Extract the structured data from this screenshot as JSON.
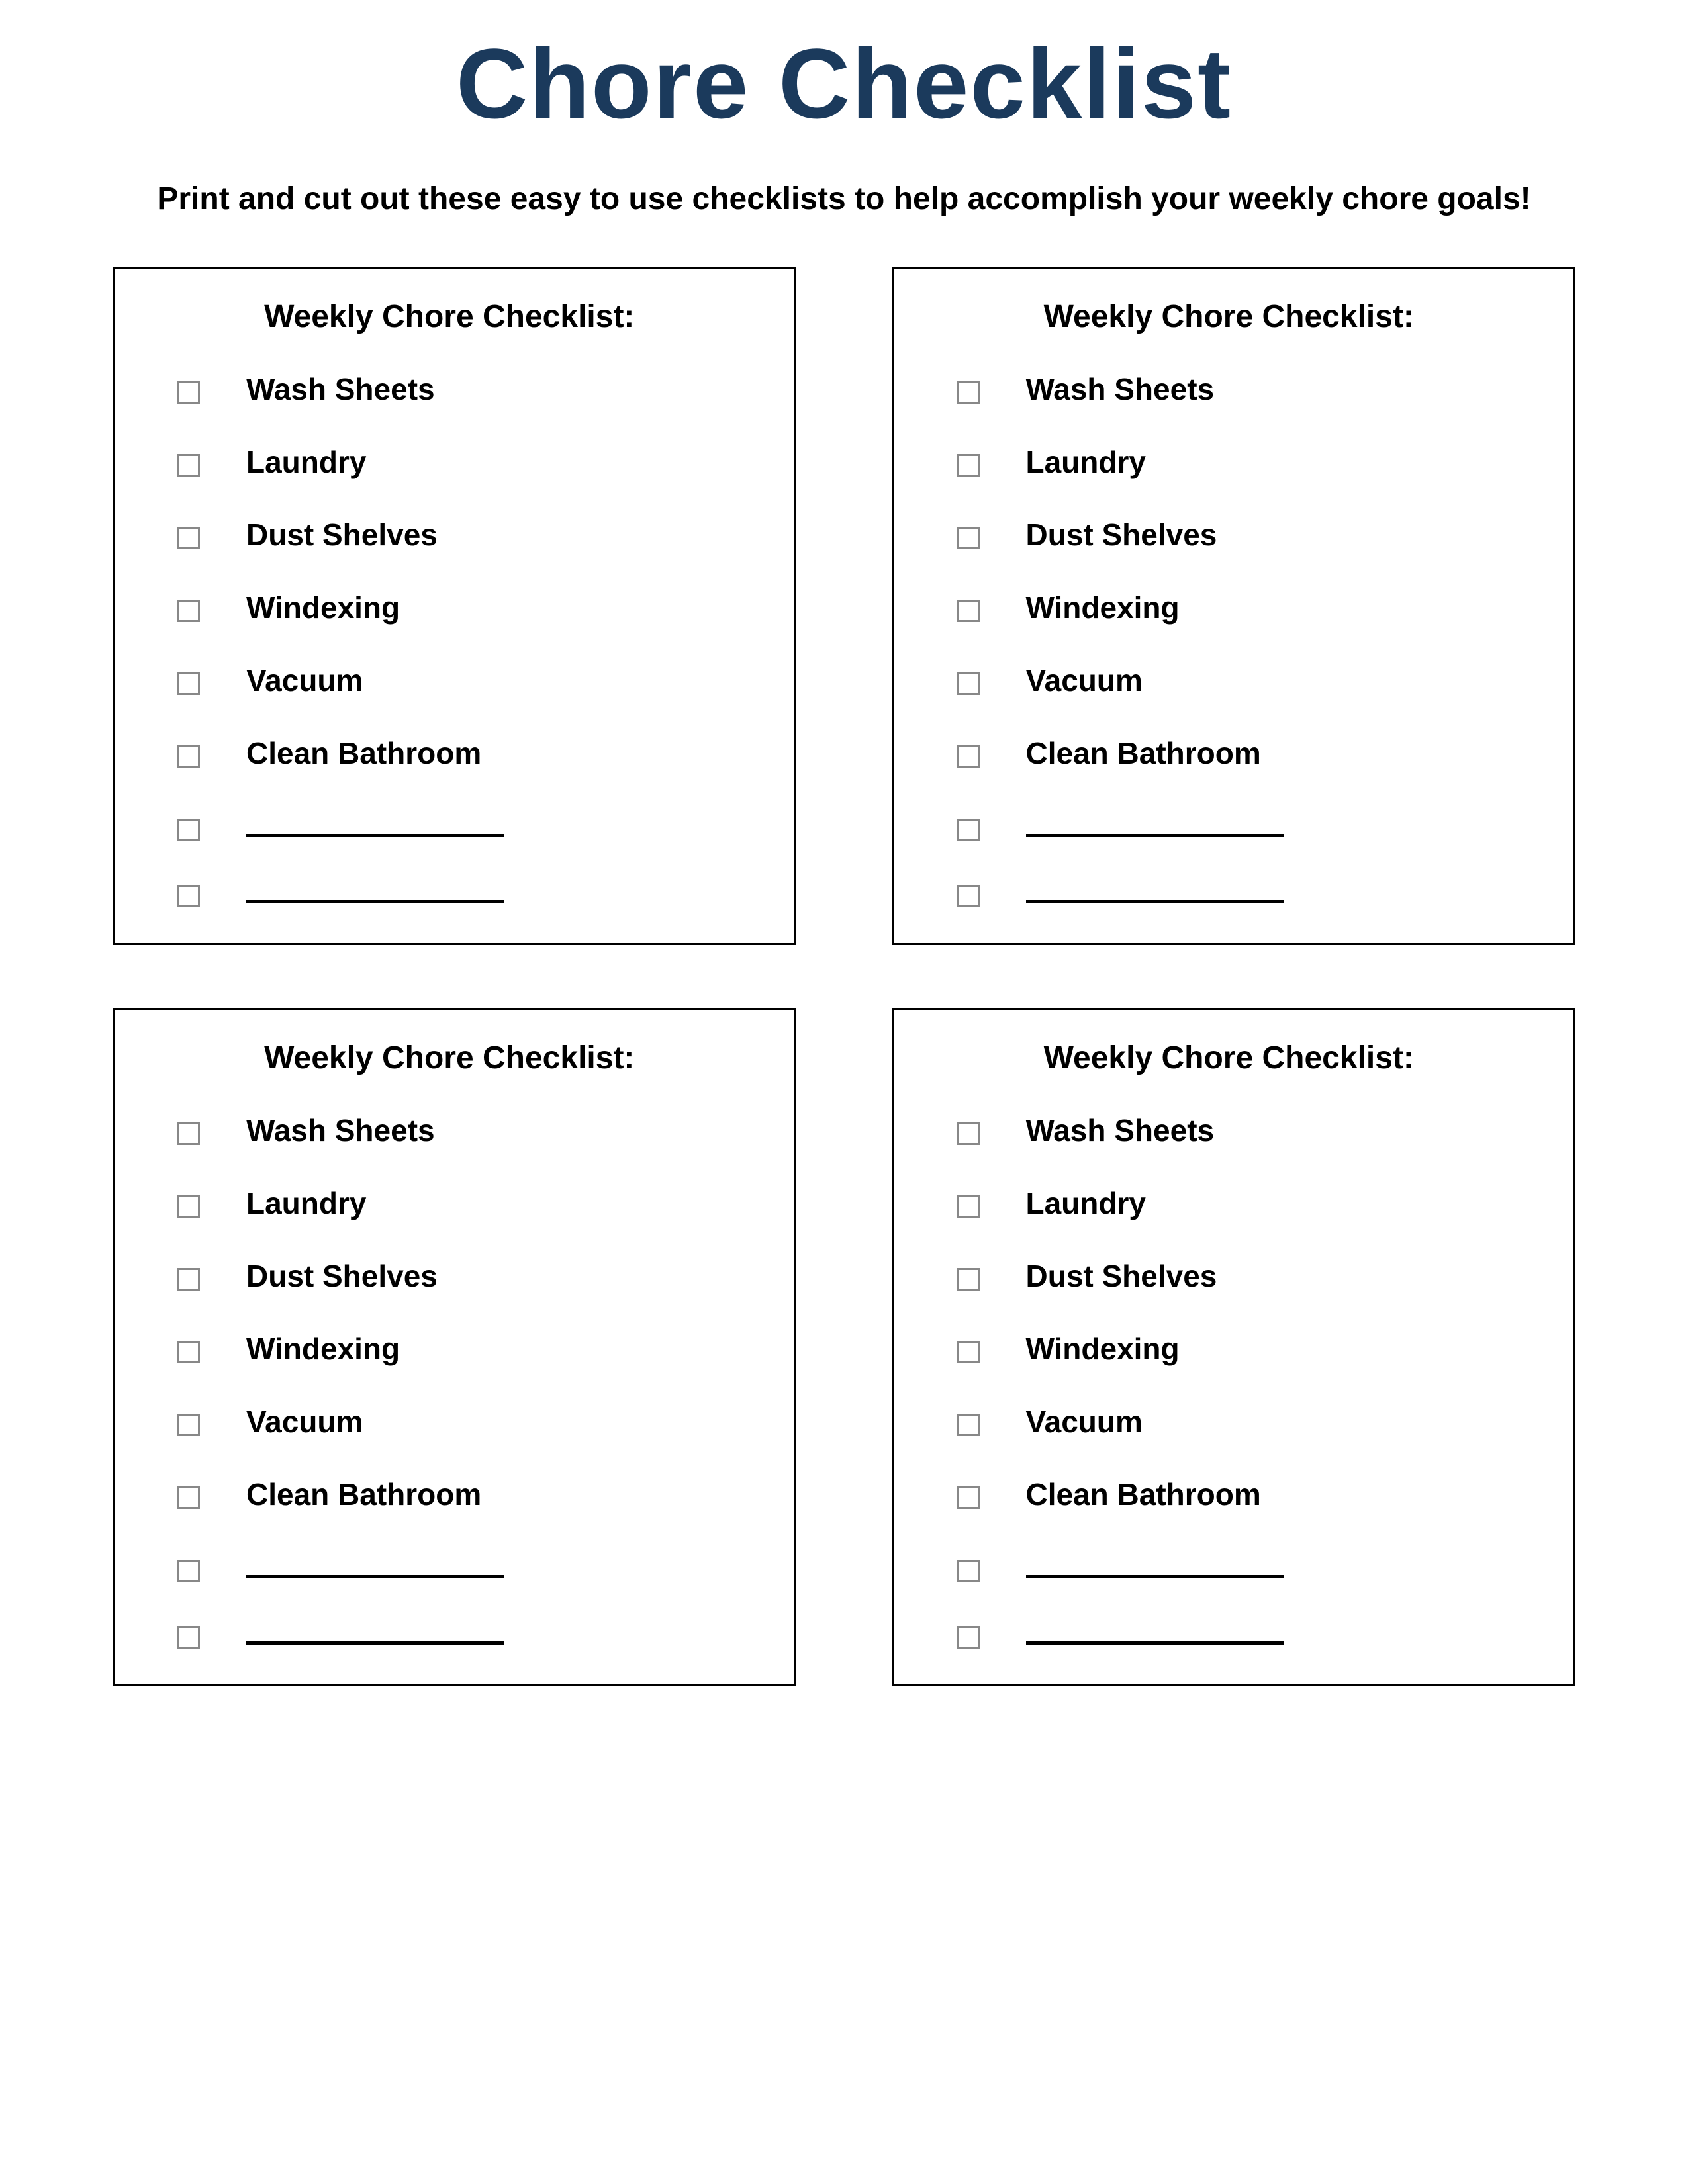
{
  "title": "Chore Checklist",
  "subtitle": "Print and cut out these easy to use checklists to help accomplish your weekly chore goals!",
  "card_title": "Weekly Chore Checklist:",
  "cards": [
    {
      "items": [
        {
          "label": "Wash Sheets",
          "blank": false
        },
        {
          "label": "Laundry",
          "blank": false
        },
        {
          "label": "Dust Shelves",
          "blank": false
        },
        {
          "label": "Windexing",
          "blank": false
        },
        {
          "label": "Vacuum",
          "blank": false
        },
        {
          "label": "Clean Bathroom",
          "blank": false
        },
        {
          "label": "",
          "blank": true
        },
        {
          "label": "",
          "blank": true
        }
      ]
    },
    {
      "items": [
        {
          "label": "Wash Sheets",
          "blank": false
        },
        {
          "label": "Laundry",
          "blank": false
        },
        {
          "label": "Dust Shelves",
          "blank": false
        },
        {
          "label": "Windexing",
          "blank": false
        },
        {
          "label": "Vacuum",
          "blank": false
        },
        {
          "label": "Clean Bathroom",
          "blank": false
        },
        {
          "label": "",
          "blank": true
        },
        {
          "label": "",
          "blank": true
        }
      ]
    },
    {
      "items": [
        {
          "label": "Wash Sheets",
          "blank": false
        },
        {
          "label": "Laundry",
          "blank": false
        },
        {
          "label": "Dust Shelves",
          "blank": false
        },
        {
          "label": "Windexing",
          "blank": false
        },
        {
          "label": "Vacuum",
          "blank": false
        },
        {
          "label": "Clean Bathroom",
          "blank": false
        },
        {
          "label": "",
          "blank": true
        },
        {
          "label": "",
          "blank": true
        }
      ]
    },
    {
      "items": [
        {
          "label": "Wash Sheets",
          "blank": false
        },
        {
          "label": "Laundry",
          "blank": false
        },
        {
          "label": "Dust Shelves",
          "blank": false
        },
        {
          "label": "Windexing",
          "blank": false
        },
        {
          "label": "Vacuum",
          "blank": false
        },
        {
          "label": "Clean Bathroom",
          "blank": false
        },
        {
          "label": "",
          "blank": true
        },
        {
          "label": "",
          "blank": true
        }
      ]
    }
  ]
}
